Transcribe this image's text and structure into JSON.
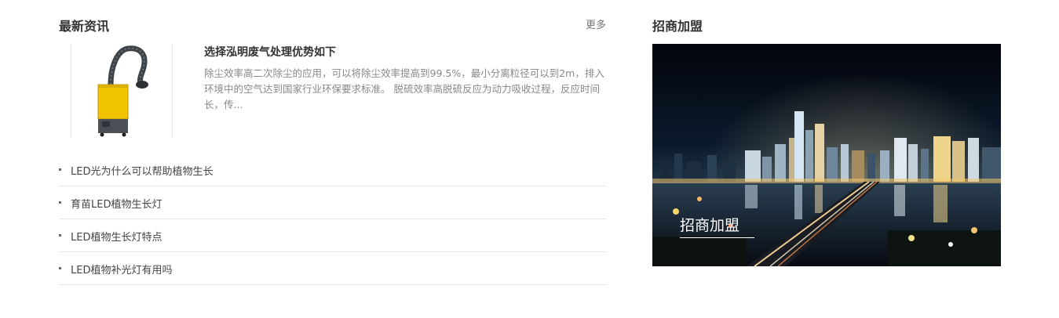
{
  "news": {
    "title": "最新资讯",
    "more": "更多",
    "feature": {
      "title": "选择泓明废气处理优势如下",
      "description": "除尘效率高二次除尘的应用，可以将除尘效率提高到99.5%，最小分离粒径可以到2m，排入环境中的空气达到国家行业环保要求标准。 脱硫效率高脱硫反应为动力吸收过程，反应时间长，传..."
    },
    "items": [
      {
        "label": "LED光为什么可以帮助植物生长"
      },
      {
        "label": "育苗LED植物生长灯"
      },
      {
        "label": "LED植物生长灯特点"
      },
      {
        "label": "LED植物补光灯有用吗"
      }
    ]
  },
  "join": {
    "title": "招商加盟",
    "banner_caption": "招商加盟"
  },
  "colors": {
    "machine_yellow": "#f2c400",
    "machine_dark": "#4a4f55",
    "night_sky": "#05070d"
  }
}
